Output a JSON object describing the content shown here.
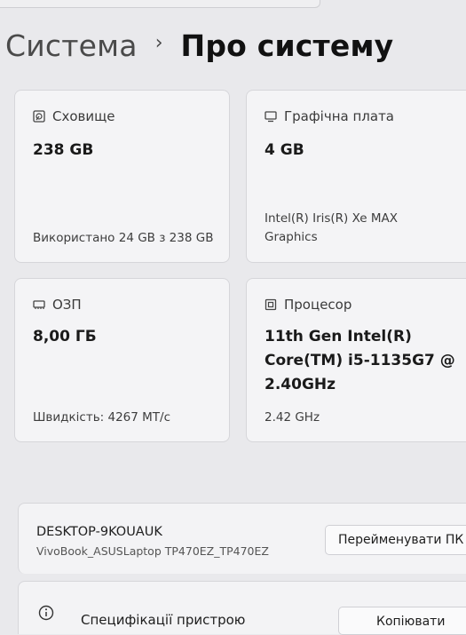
{
  "breadcrumb": {
    "parent": "Система",
    "separator": "›",
    "current": "Про систему"
  },
  "cards": {
    "storage": {
      "icon": "storage-icon",
      "title": "Сховище",
      "value": "238 GB",
      "detail": "Використано 24 GB з 238 GB"
    },
    "graphics": {
      "icon": "display-icon",
      "title": "Графічна плата",
      "value": "4 GB",
      "detail_line1": "Intel(R) Iris(R) Xe MAX",
      "detail_line2": "Graphics"
    },
    "ram": {
      "icon": "memory-icon",
      "title": "ОЗП",
      "value": "8,00 ГБ",
      "detail": "Швидкість: 4267 MT/c"
    },
    "cpu": {
      "icon": "processor-icon",
      "title": "Процесор",
      "value_line1": "11th Gen Intel(R)",
      "value_line2": "Core(TM) i5-1135G7 @",
      "value_line3": "2.40GHz",
      "detail": "2.42 GHz"
    }
  },
  "device": {
    "name": "DESKTOP-9KOUAUK",
    "model": "VivoBook_ASUSLaptop TP470EZ_TP470EZ",
    "rename_label": "Перейменувати ПК"
  },
  "specs": {
    "icon": "info-icon",
    "label": "Специфікації пристрою",
    "copy_label": "Копіювати"
  }
}
